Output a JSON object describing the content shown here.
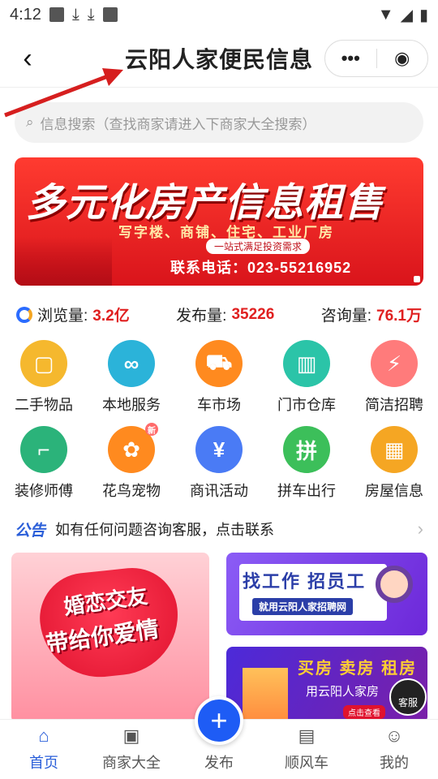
{
  "status_bar": {
    "time": "4:12"
  },
  "nav": {
    "title": "云阳人家便民信息",
    "more_icon": "more-dots-icon",
    "close_icon": "target-icon"
  },
  "search": {
    "placeholder": "信息搜索（查找商家请进入下商家大全搜索）"
  },
  "banner": {
    "headline": "多元化房产信息租售",
    "subline": "写字楼、商铺、住宅、工业厂房",
    "tag": "一站式满足投资需求",
    "phone": "联系电话：023-55216952"
  },
  "stats": [
    {
      "label": "浏览量:",
      "value": "3.2亿"
    },
    {
      "label": "发布量:",
      "value": "35226"
    },
    {
      "label": "咨询量:",
      "value": "76.1万"
    }
  ],
  "categories": [
    {
      "label": "二手物品",
      "color": "#f5b82e",
      "glyph": "▢"
    },
    {
      "label": "本地服务",
      "color": "#2bb3d9",
      "glyph": "∞"
    },
    {
      "label": "车市场",
      "color": "#ff8a1f",
      "glyph": "⛟"
    },
    {
      "label": "门市仓库",
      "color": "#2bc4a8",
      "glyph": "▥"
    },
    {
      "label": "简洁招聘",
      "color": "#ff7b7b",
      "glyph": "⚡"
    },
    {
      "label": "装修师傅",
      "color": "#2bb37a",
      "glyph": "⌐"
    },
    {
      "label": "花鸟宠物",
      "color": "#ff8a1f",
      "glyph": "✿"
    },
    {
      "label": "商讯活动",
      "color": "#4a7bf5",
      "glyph": "¥"
    },
    {
      "label": "拼车出行",
      "color": "#3cbf5a",
      "glyph": "拼"
    },
    {
      "label": "房屋信息",
      "color": "#f5a623",
      "glyph": "▦"
    }
  ],
  "notice": {
    "tag": "公告",
    "text": "如有任何问题咨询客服，点击联系"
  },
  "promo": {
    "love_line1": "婚恋交友",
    "love_line2": "带给你爱情",
    "job_title": "找工作  招员工",
    "job_sub": "就用云阳人家招聘网",
    "house_title": "买房 卖房 租房",
    "house_sub": "用云阳人家房",
    "house_btn": "点击查看",
    "service": "客服"
  },
  "tabs": [
    {
      "label": "首页",
      "icon": "home-icon",
      "glyph": "⌂"
    },
    {
      "label": "商家大全",
      "icon": "shop-icon",
      "glyph": "▣"
    },
    {
      "label": "发布",
      "icon": "plus-icon",
      "glyph": "+"
    },
    {
      "label": "顺风车",
      "icon": "note-icon",
      "glyph": "▤"
    },
    {
      "label": "我的",
      "icon": "user-icon",
      "glyph": "☺"
    }
  ],
  "colors": {
    "accent": "#2b5fd9",
    "highlight": "#e02020",
    "fab": "#1e5cf5"
  }
}
